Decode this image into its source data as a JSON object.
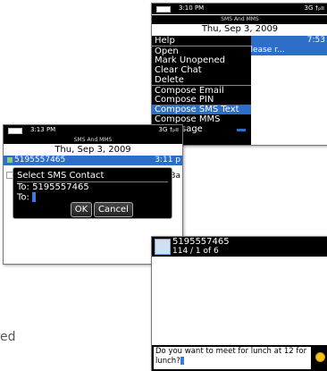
{
  "screen_menu": {
    "status": {
      "time": "3:10 PM",
      "network": "3G †ₚıı"
    },
    "app_title": "SMS And MMS",
    "date": "Thu, Sep 3, 2009",
    "message_time": "7:53",
    "message_preview": "Number. Please r...",
    "menu_items": [
      "Help",
      "Open",
      "Mark Unopened",
      "Clear Chat",
      "Delete",
      "Compose Email",
      "Compose PIN",
      "Compose SMS Text",
      "Compose MMS",
      "Message"
    ],
    "highlighted": "Compose SMS Text"
  },
  "screen_contact": {
    "status": {
      "time": "3:13 PM",
      "network": "3G †ₚıı"
    },
    "app_title": "SMS And MMS",
    "date": "Thu, Sep 3, 2009",
    "row_number": "5195557465",
    "row_time": "3:11 p",
    "row2_time": "3a",
    "dialog": {
      "title": "Select SMS Contact",
      "line1": "To: 5195557465",
      "line2": "To:",
      "ok": "OK",
      "cancel": "Cancel"
    }
  },
  "screen_compose": {
    "contact": "5195557465",
    "counter": "114 / 1 of 6",
    "message": "Do you want to meet for lunch at 12 for lunch?"
  },
  "page_fragment": "ed"
}
